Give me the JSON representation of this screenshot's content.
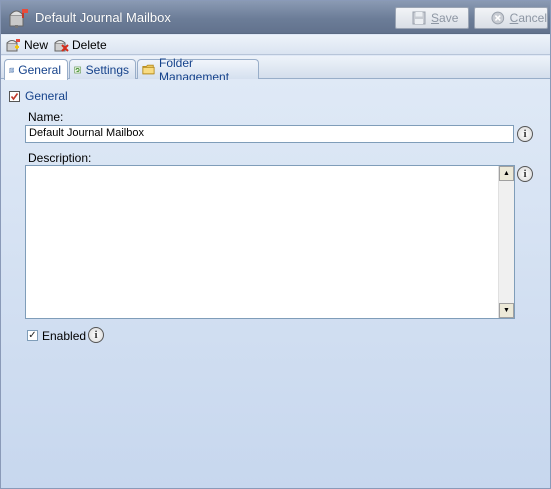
{
  "window": {
    "title": "Default Journal Mailbox",
    "icon": "mailbox-icon"
  },
  "titlebar": {
    "save": {
      "prefix": "",
      "underlined": "S",
      "rest": "ave",
      "icon": "floppy-disk-icon",
      "enabled": false
    },
    "cancel": {
      "prefix": "",
      "underlined": "C",
      "rest": "ancel",
      "icon": "cancel-circle-icon",
      "enabled": false
    }
  },
  "toolbar": {
    "new_label": "New",
    "delete_label": "Delete"
  },
  "tabs": [
    {
      "label": "General",
      "icon": "general-page-icon",
      "active": true
    },
    {
      "label": "Settings",
      "icon": "settings-icon",
      "active": false
    },
    {
      "label": "Folder Management",
      "icon": "folder-icon",
      "active": false
    }
  ],
  "general": {
    "section_title": "General",
    "name_label": "Name:",
    "name_value": "Default Journal Mailbox",
    "description_label": "Description:",
    "description_value": "",
    "enabled_label": "Enabled",
    "enabled_checked": true
  },
  "colors": {
    "titlebar": "#6c7d98",
    "tab_text": "#15428b",
    "content_bg": "#dfe9f6"
  }
}
